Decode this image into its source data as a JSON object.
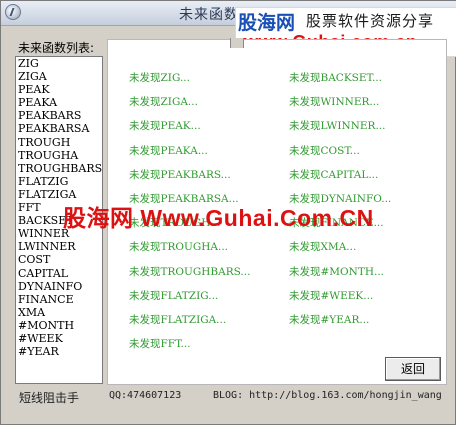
{
  "window": {
    "title": "未来函数"
  },
  "brand": {
    "logo": "股海网",
    "slogan": "股票软件资源分享",
    "url": "www.Guhai.com.cn"
  },
  "list": {
    "label": "未来函数列表:",
    "items": [
      "ZIG",
      "ZIGA",
      "PEAK",
      "PEAKA",
      "PEAKBARS",
      "PEAKBARSA",
      "TROUGH",
      "TROUGHA",
      "TROUGHBARS",
      "FLATZIG",
      "FLATZIGA",
      "FFT",
      "BACKSET",
      "WINNER",
      "LWINNER",
      "COST",
      "CAPITAL",
      "DYNAINFO",
      "FINANCE",
      "XMA",
      "#MONTH",
      "#WEEK",
      "#YEAR"
    ]
  },
  "results": {
    "left": [
      "未发现ZIG...",
      "未发现ZIGA...",
      "未发现PEAK...",
      "未发现PEAKA...",
      "未发现PEAKBARS...",
      "未发现PEAKBARSA...",
      "未发现TROUGH...",
      "未发现TROUGHA...",
      "未发现TROUGHBARS...",
      "未发现FLATZIG...",
      "未发现FLATZIGA...",
      "未发现FFT..."
    ],
    "right": [
      "未发现BACKSET...",
      "未发现WINNER...",
      "未发现LWINNER...",
      "未发现COST...",
      "未发现CAPITAL...",
      "未发现DYNAINFO...",
      "未发现FINANCE...",
      "未发现XMA...",
      "未发现#MONTH...",
      "未发现#WEEK...",
      "未发现#YEAR..."
    ]
  },
  "buttons": {
    "back": "返回"
  },
  "watermark": "股海网 Www.Guhai.Com.CN",
  "status": {
    "author": "短线阻击手",
    "qq": "QQ:474607123",
    "blog": "BLOG: http://blog.163.com/hongjin_wang"
  },
  "colors": {
    "result_text": "#2e9a2e",
    "watermark": "#dd1111",
    "brand_logo": "#1a4fb5"
  }
}
